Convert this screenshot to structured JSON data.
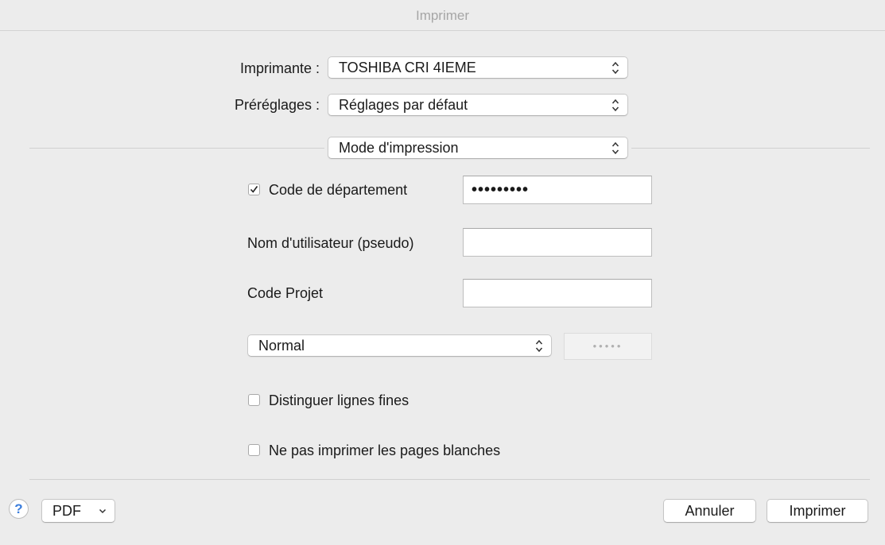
{
  "window": {
    "title": "Imprimer"
  },
  "printer": {
    "label": "Imprimante :",
    "value": "TOSHIBA CRI 4IEME"
  },
  "presets": {
    "label": "Préréglages :",
    "value": "Réglages par défaut"
  },
  "section": {
    "value": "Mode d'impression"
  },
  "department_code": {
    "label": "Code de département",
    "checked": true,
    "value": "•••••••••"
  },
  "username": {
    "label": "Nom d'utilisateur (pseudo)",
    "value": ""
  },
  "project_code": {
    "label": "Code Projet",
    "value": ""
  },
  "mode": {
    "value": "Normal",
    "secondary_value": "•••••"
  },
  "thin_lines": {
    "label": "Distinguer lignes fines",
    "checked": false
  },
  "skip_blank": {
    "label": "Ne pas imprimer les pages blanches",
    "checked": false
  },
  "footer": {
    "help_icon": "question-mark-icon",
    "help_label": "?",
    "pdf_label": "PDF",
    "cancel_label": "Annuler",
    "print_label": "Imprimer"
  },
  "colors": {
    "accent": "#3a7ddc",
    "background": "#ececec"
  }
}
